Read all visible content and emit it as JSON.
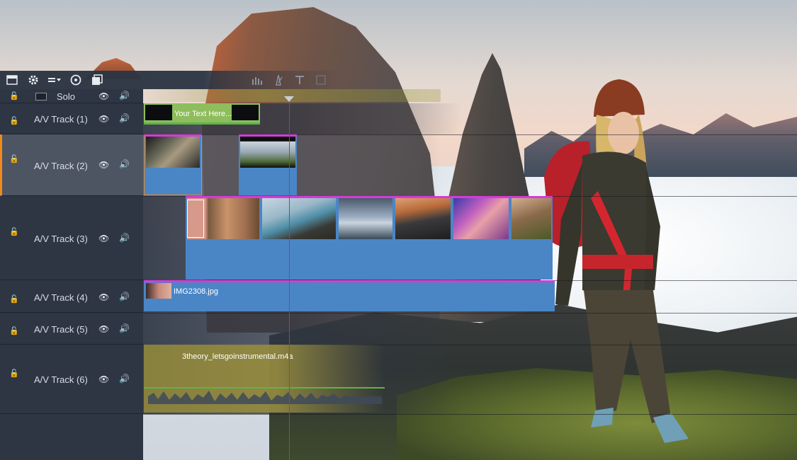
{
  "toolbar": {
    "icons": [
      "storyboard-icon",
      "settings-gear-icon",
      "track-options-icon",
      "disc-icon",
      "overlay-icon",
      "audio-levels-icon",
      "metronome-icon",
      "title-icon",
      "text-icon"
    ]
  },
  "solo": {
    "label": "Solo"
  },
  "tracks": [
    {
      "label": "A/V Track (1)"
    },
    {
      "label": "A/V Track (2)"
    },
    {
      "label": "A/V Track (3)"
    },
    {
      "label": "A/V Track (4)"
    },
    {
      "label": "A/V Track (5)"
    },
    {
      "label": "A/V Track (6)"
    }
  ],
  "clips": {
    "title_text": "Your Text Here...",
    "image_file": "IMG2308.jpg",
    "audio_file": "3theory_letsgoinstrumental.m4a"
  },
  "colors": {
    "selected_accent": "#f08a1c",
    "clip_blue": "#4a86c6",
    "clip_border": "#d63ad8",
    "playhead": "#c0392b",
    "title_green": "#8ebd5c",
    "audio_gold": "#8c843c"
  }
}
